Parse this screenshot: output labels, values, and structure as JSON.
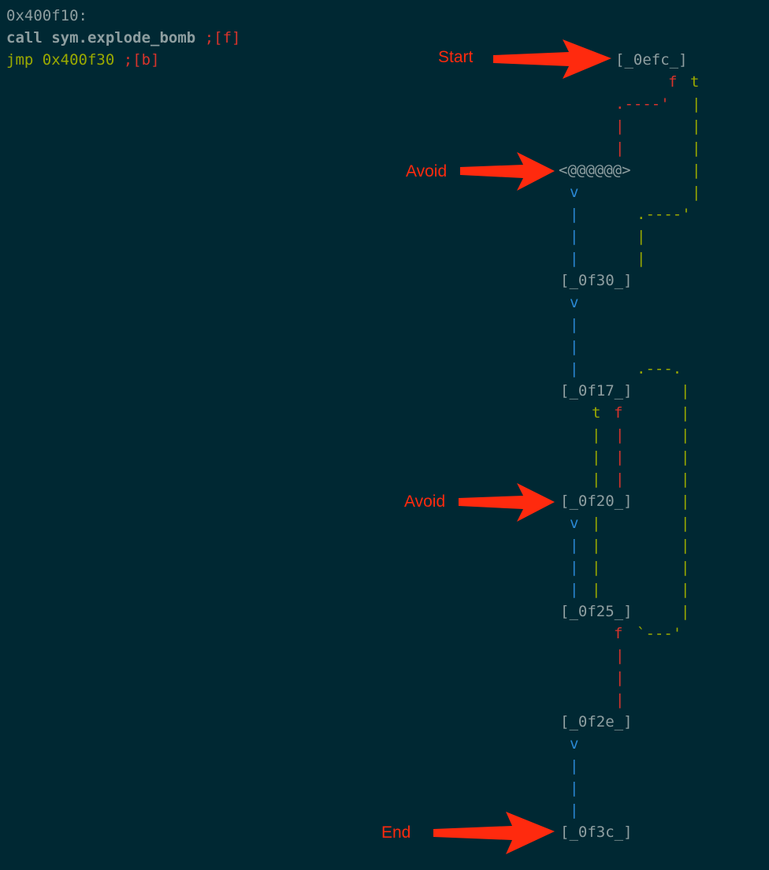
{
  "code": {
    "address_label": "0x400f10:",
    "line_call_keyword": "call",
    "line_call_target": "sym.explode_bomb",
    "line_call_comment": ";[f]",
    "line_jmp_keyword": "jmp",
    "line_jmp_target": "0x400f30",
    "line_jmp_comment": ";[b]"
  },
  "graph": {
    "nodes": {
      "n0efc": "[_0efc_]",
      "nexplode": "<@@@@@@>",
      "n0f30": "[_0f30_]",
      "n0f17": "[_0f17_]",
      "n0f20": "[_0f20_]",
      "n0f25": "[_0f25_]",
      "n0f2e": "[_0f2e_]",
      "n0f3c": "[_0f3c_]"
    },
    "edge_labels": {
      "efc_f": "f",
      "efc_t": "t",
      "f17_t": "t",
      "f17_f": "f",
      "f25_f": "f",
      "down_arrow": "v",
      "v_bar": "|",
      "corner_efc_f": ".----'",
      "corner_efc_t": ".----'",
      "corner_loop_top": ".---.",
      "corner_loop_bottom": "`---'"
    }
  },
  "annotations": {
    "start": "Start",
    "avoid_1": "Avoid",
    "avoid_2": "Avoid",
    "end": "End"
  },
  "colors": {
    "background": "#002833",
    "text_gray": "#8e9ea0",
    "edge_true_yellow": "#9aaa00",
    "edge_false_red": "#d9342c",
    "edge_uncond_blue": "#2a88d4",
    "annotation_red": "#ff2a0e"
  }
}
